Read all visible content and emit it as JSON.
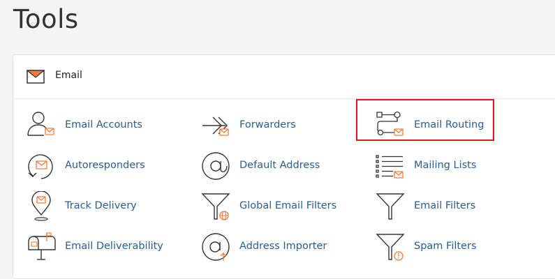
{
  "page": {
    "title": "Tools"
  },
  "section": {
    "title": "Email",
    "icon": "envelope-icon"
  },
  "items": [
    {
      "label": "Email Accounts",
      "icon": "user-envelope-icon"
    },
    {
      "label": "Forwarders",
      "icon": "forward-arrow-icon"
    },
    {
      "label": "Email Routing",
      "icon": "routing-icon"
    },
    {
      "label": "Autoresponders",
      "icon": "autoresponder-icon"
    },
    {
      "label": "Default Address",
      "icon": "at-sign-icon"
    },
    {
      "label": "Mailing Lists",
      "icon": "mailing-list-icon"
    },
    {
      "label": "Track Delivery",
      "icon": "location-pin-icon"
    },
    {
      "label": "Global Email Filters",
      "icon": "funnel-globe-icon"
    },
    {
      "label": "Email Filters",
      "icon": "funnel-icon"
    },
    {
      "label": "Email Deliverability",
      "icon": "mailbox-icon"
    },
    {
      "label": "Address Importer",
      "icon": "at-import-icon"
    },
    {
      "label": "Spam Filters",
      "icon": "funnel-clock-icon"
    }
  ],
  "colors": {
    "accent": "#ee7d3a",
    "link": "#2a5d91",
    "icon": "#333333",
    "highlight": "#e0141e"
  }
}
